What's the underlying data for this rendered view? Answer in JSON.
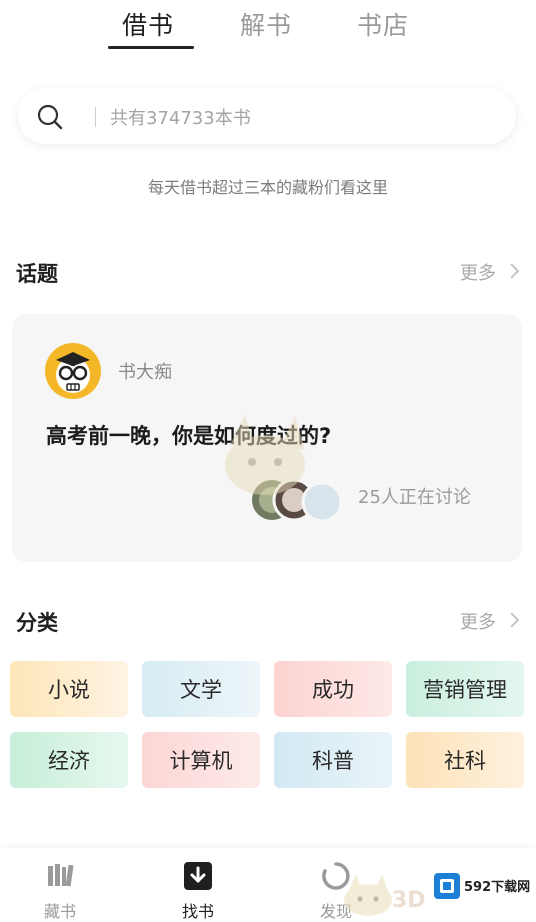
{
  "top_tabs": [
    {
      "label": "借书",
      "active": true
    },
    {
      "label": "解书",
      "active": false
    },
    {
      "label": "书店",
      "active": false
    }
  ],
  "search": {
    "placeholder": "共有374733本书",
    "icon": "search-icon"
  },
  "search_hint": "每天借书超过三本的藏粉们看这里",
  "topics": {
    "title": "话题",
    "more": "更多",
    "card": {
      "author": "书大痴",
      "question": "高考前一晚，你是如何度过的?",
      "discussing": "25人正在讨论"
    }
  },
  "categories": {
    "title": "分类",
    "more": "更多",
    "items": [
      "小说",
      "文学",
      "成功",
      "营销管理",
      "经济",
      "计算机",
      "科普",
      "社科"
    ]
  },
  "bottom_nav": [
    {
      "label": "藏书",
      "icon": "bookshelf-icon",
      "active": false
    },
    {
      "label": "找书",
      "icon": "find-book-icon",
      "active": true
    },
    {
      "label": "发现",
      "icon": "discover-icon",
      "active": false
    },
    {
      "label": "",
      "icon": "profile-icon",
      "active": false
    }
  ],
  "watermark": {
    "text": "592下载网",
    "mark": "3D"
  },
  "colors": {
    "accent": "#1f1f1f",
    "muted": "#9a9a9a",
    "card_bg": "#f6f6f6"
  }
}
